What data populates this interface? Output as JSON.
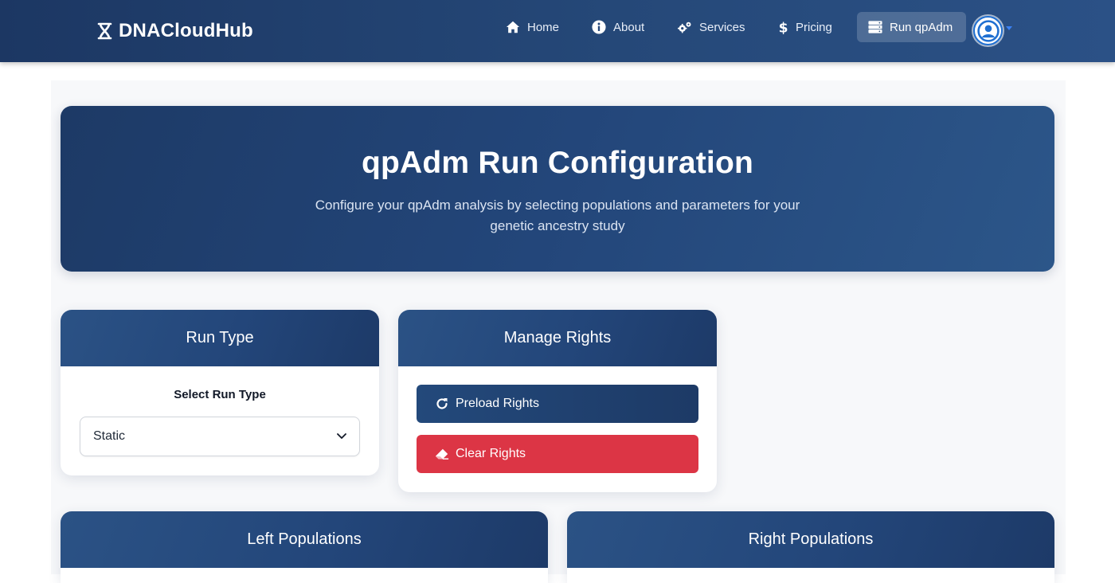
{
  "brand": {
    "name": "DNACloudHub"
  },
  "nav": {
    "items": [
      {
        "label": "Home",
        "icon": "home-icon"
      },
      {
        "label": "About",
        "icon": "info-icon"
      },
      {
        "label": "Services",
        "icon": "gears-icon"
      },
      {
        "label": "Pricing",
        "icon": "dollar-icon"
      },
      {
        "label": "Run qpAdm",
        "icon": "server-icon",
        "active": true
      }
    ],
    "user_menu": {
      "icon": "user-circle-icon"
    }
  },
  "hero": {
    "title": "qpAdm Run Configuration",
    "subtitle": "Configure your qpAdm analysis by selecting populations and parameters for your genetic ancestry study"
  },
  "run_type_card": {
    "title": "Run Type",
    "field_label": "Select Run Type",
    "selected": "Static"
  },
  "rights_card": {
    "title": "Manage Rights",
    "preload_label": "Preload Rights",
    "clear_label": "Clear Rights"
  },
  "left_populations": {
    "title": "Left Populations"
  },
  "right_populations": {
    "title": "Right Populations"
  },
  "colors": {
    "primary": "#23467a",
    "danger": "#dc3545",
    "accent": "#3b82f6"
  }
}
